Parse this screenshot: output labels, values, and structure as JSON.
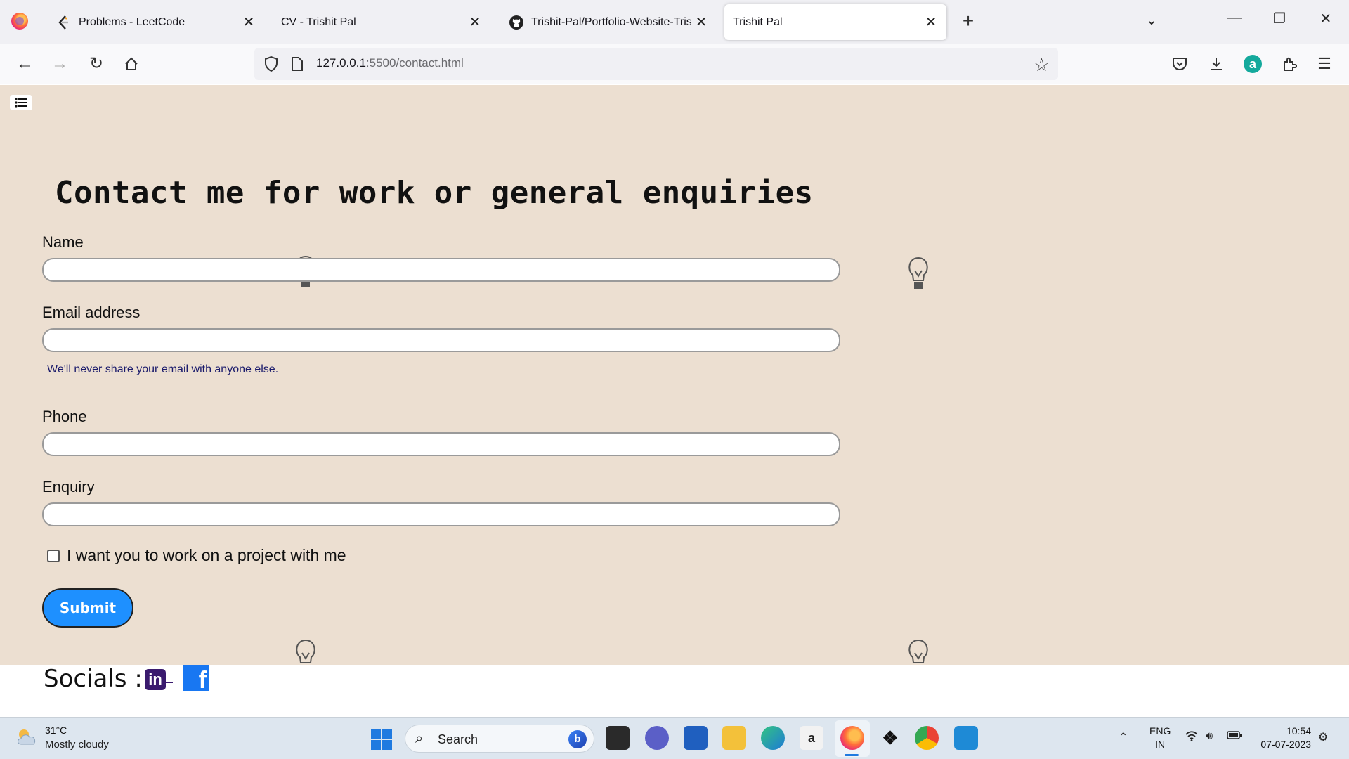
{
  "browser": {
    "tabs": [
      {
        "title": "Problems - LeetCode",
        "icon": "leetcode-icon",
        "active": false
      },
      {
        "title": "CV - Trishit Pal",
        "icon": "none",
        "active": false
      },
      {
        "title": "Trishit-Pal/Portfolio-Website-Trishit",
        "icon": "github-icon",
        "active": false
      },
      {
        "title": "Trishit Pal",
        "icon": "none",
        "active": true
      }
    ],
    "url_host": "127.0.0.1",
    "url_path": ":5500/contact.html"
  },
  "page": {
    "background": "#ecdfd1",
    "title": "Contact me for work or general enquiries",
    "form": {
      "name_label": "Name",
      "name_value": "",
      "email_label": "Email address",
      "email_value": "",
      "email_help": "We'll never share your email with anyone else.",
      "phone_label": "Phone",
      "phone_value": "",
      "enquiry_label": "Enquiry",
      "enquiry_value": "",
      "checkbox_label": "I want you to work on a project with me",
      "checkbox_checked": false,
      "submit_label": "Submit",
      "submit_color": "#1e90ff"
    },
    "socials": {
      "label": "Socials :",
      "linkedin_glyph": "in",
      "facebook_glyph": "f"
    }
  },
  "taskbar": {
    "weather_temp": "31°C",
    "weather_desc": "Mostly cloudy",
    "search_placeholder": "Search",
    "language_line1": "ENG",
    "language_line2": "IN",
    "time": "10:54",
    "date": "07-07-2023"
  }
}
